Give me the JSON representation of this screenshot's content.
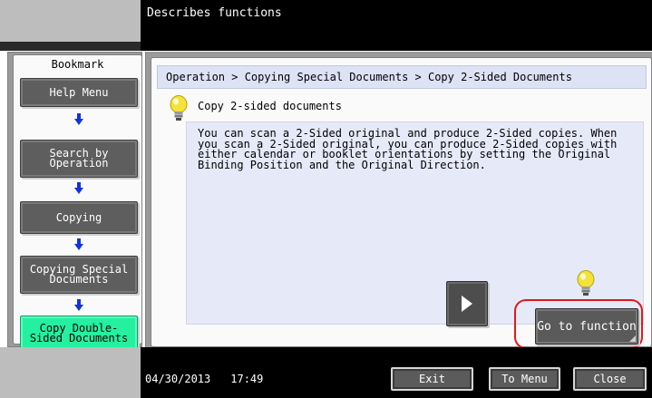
{
  "header": {
    "title": "Describes functions"
  },
  "sidebar": {
    "title": "Bookmark",
    "items": [
      {
        "label": "Help Menu"
      },
      {
        "label": "Search by\nOperation"
      },
      {
        "label": "Copying"
      },
      {
        "label": "Copying Special\nDocuments"
      },
      {
        "label": "Copy Double-\nSided Documents"
      }
    ]
  },
  "main": {
    "breadcrumb": "Operation > Copying Special Documents > Copy 2-Sided Documents",
    "topic_title": "Copy 2-sided documents",
    "description": "You can scan a 2-Sided original and produce 2-Sided copies. When you scan a 2-Sided original, you can produce 2-Sided copies with either calendar or booklet orientations by setting the Original Binding Position and the Original Direction.",
    "goto_button": "Go to function"
  },
  "footer": {
    "date": "04/30/2013",
    "time": "17:49",
    "exit_label": "Exit",
    "to_menu_label": "To Menu",
    "close_label": "Close"
  },
  "colors": {
    "current_item": "#24f0a0",
    "breadcrumb_bg": "#dde2f4",
    "description_bg": "#e6e9f7",
    "highlight": "#e01a1a",
    "arrow": "#1431e0"
  },
  "icons": [
    "lightbulb-icon",
    "down-arrow-icon",
    "play-right-icon"
  ]
}
